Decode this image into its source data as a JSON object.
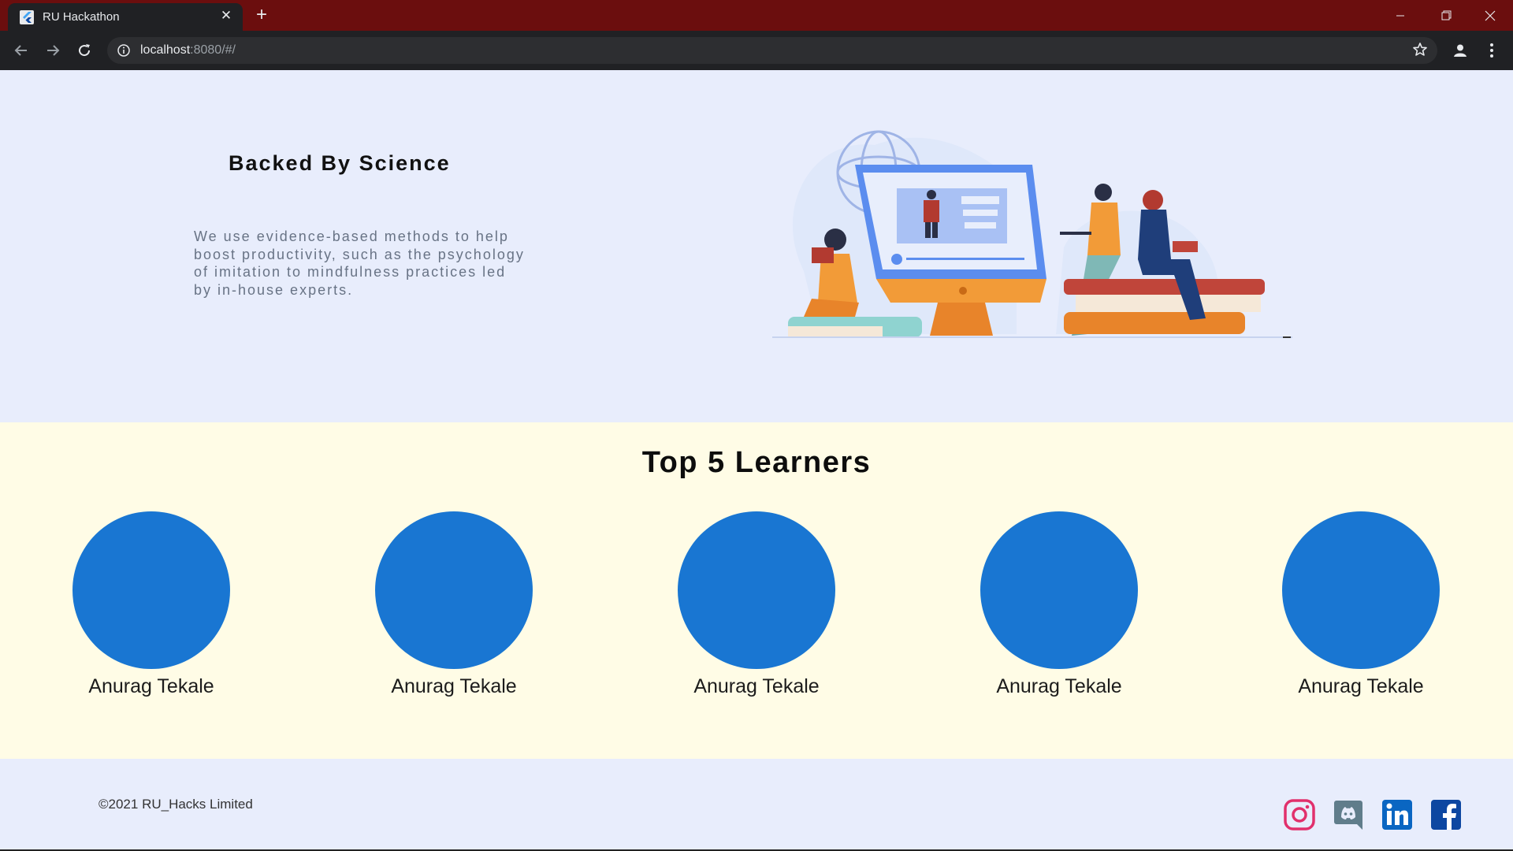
{
  "browser": {
    "tab_title": "RU Hackathon",
    "url_host": "localhost",
    "url_rest": ":8080/#/"
  },
  "hero": {
    "title": "Backed By Science",
    "description": "We use evidence-based methods to help boost productivity, such as the psychology of imitation to mindfulness practices led by in-house experts."
  },
  "learners": {
    "title": "Top 5 Learners",
    "items": [
      {
        "name": "Anurag Tekale"
      },
      {
        "name": "Anurag Tekale"
      },
      {
        "name": "Anurag Tekale"
      },
      {
        "name": "Anurag Tekale"
      },
      {
        "name": "Anurag Tekale"
      }
    ],
    "avatar_color": "#1976d2"
  },
  "footer": {
    "copyright": "©2021 RU_Hacks Limited",
    "social": [
      "instagram-icon",
      "discord-icon",
      "linkedin-icon",
      "facebook-icon"
    ]
  },
  "colors": {
    "hero_bg": "#e8edfc",
    "learners_bg": "#fffce6",
    "tabbar_bg": "#6b0e0e"
  }
}
